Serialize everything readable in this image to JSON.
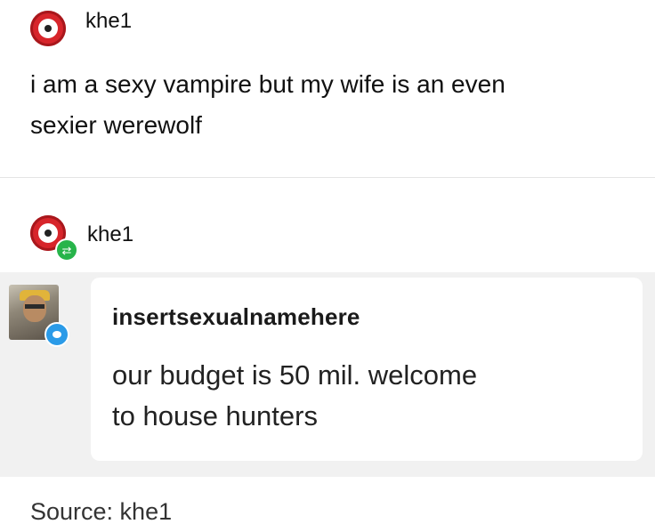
{
  "original_post": {
    "username": "khe1",
    "text_line1": "i am a sexy vampire but my wife is an even",
    "text_line2": "sexier werewolf"
  },
  "reblog": {
    "username": "khe1",
    "badge_icon": "reblog-icon"
  },
  "reply": {
    "username": "insertsexualnamehere",
    "text_line1": "our budget is 50 mil. welcome",
    "text_line2": "to house hunters",
    "badge_icon": "speech-bubble-icon"
  },
  "source": {
    "text": "Source: khe1"
  },
  "colors": {
    "avatar_red": "#d7252b",
    "reblog_green": "#27b44a",
    "reply_blue": "#2b9be8",
    "band_gray": "#f1f1f1"
  }
}
